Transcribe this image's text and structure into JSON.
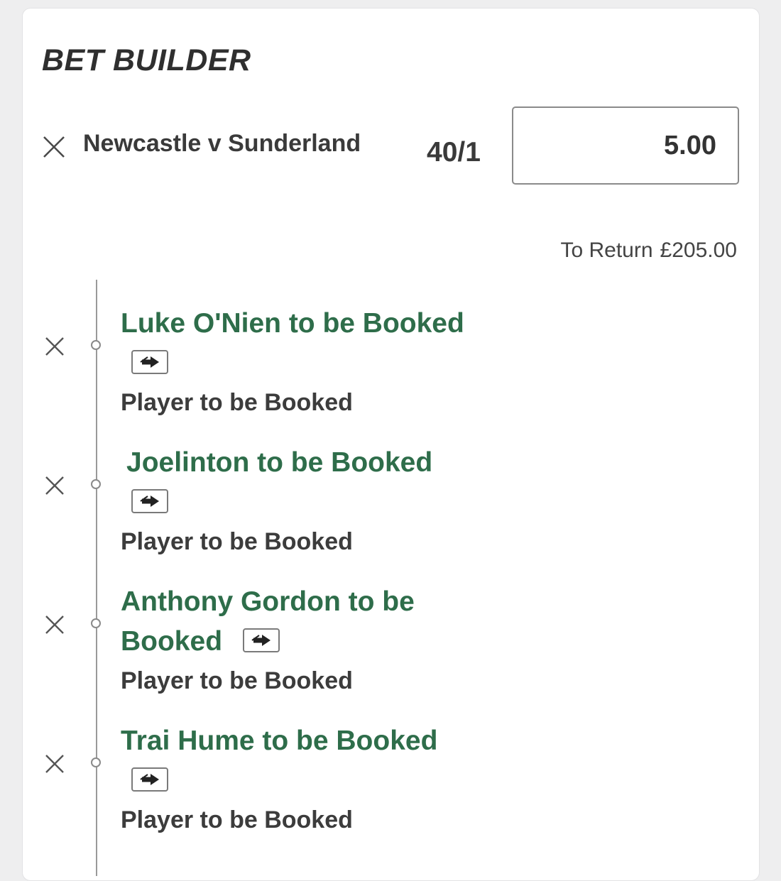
{
  "header": {
    "title": "BET BUILDER"
  },
  "bet": {
    "event": "Newcastle v Sunderland",
    "odds": "40/1",
    "stake": "5.00",
    "to_return_label": "To Return",
    "to_return_value": "£205.00"
  },
  "legs": [
    {
      "title_line1": "Luke O'Nien to be Booked",
      "title_line2": "",
      "market": "Player to be Booked"
    },
    {
      "title_line1": "Joelinton to be Booked",
      "title_line2": "",
      "market": "Player to be Booked"
    },
    {
      "title_line1": "Anthony Gordon to be",
      "title_line2": "Booked",
      "market": "Player to be Booked"
    },
    {
      "title_line1": "Trai Hume to be Booked",
      "title_line2": "",
      "market": "Player to be Booked"
    }
  ],
  "icons": {
    "remove": "close-icon",
    "swap": "swap-arrow-icon"
  },
  "colors": {
    "leg_title": "#2e6d4a",
    "text": "#3a3a3a",
    "background": "#eeeeef",
    "card": "#ffffff"
  }
}
